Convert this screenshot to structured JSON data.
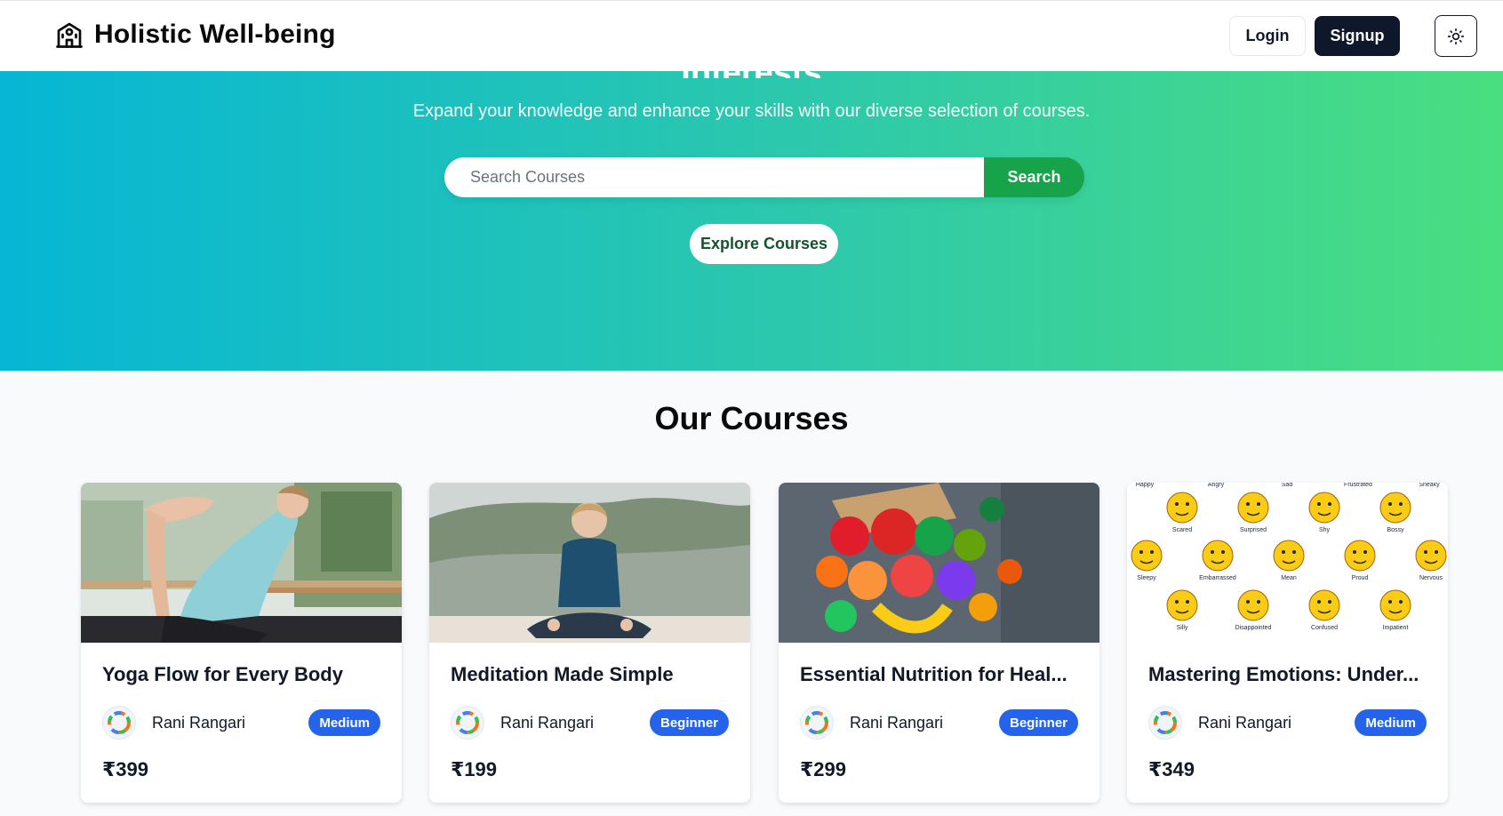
{
  "header": {
    "brand": "Holistic Well-being",
    "login_label": "Login",
    "signup_label": "Signup"
  },
  "hero": {
    "clipped_title": "Interests",
    "subtitle": "Expand your knowledge and enhance your skills with our diverse selection of courses.",
    "search_placeholder": "Search Courses",
    "search_label": "Search",
    "explore_label": "Explore Courses"
  },
  "courses": {
    "heading": "Our Courses",
    "items": [
      {
        "title": "Yoga Flow for Every Body",
        "author": "Rani Rangari",
        "level": "Medium",
        "price": "₹399"
      },
      {
        "title": "Meditation Made Simple",
        "author": "Rani Rangari",
        "level": "Beginner",
        "price": "₹199"
      },
      {
        "title": "Essential Nutrition for Heal...",
        "author": "Rani Rangari",
        "level": "Beginner",
        "price": "₹299"
      },
      {
        "title": "Mastering Emotions: Under...",
        "author": "Rani Rangari",
        "level": "Medium",
        "price": "₹349"
      }
    ]
  },
  "emotions": [
    "Happy",
    "Angry",
    "Sad",
    "Frustrated",
    "Sneaky",
    "Scared",
    "Surprised",
    "Shy",
    "Bossy",
    "Sleepy",
    "Embarrassed",
    "Mean",
    "Proud",
    "Nervous",
    "Silly",
    "Disappointed",
    "Confused",
    "Impatient"
  ],
  "colors": {
    "accent_green": "#16a34a",
    "badge_blue": "#2563eb",
    "dark": "#0f172a"
  }
}
